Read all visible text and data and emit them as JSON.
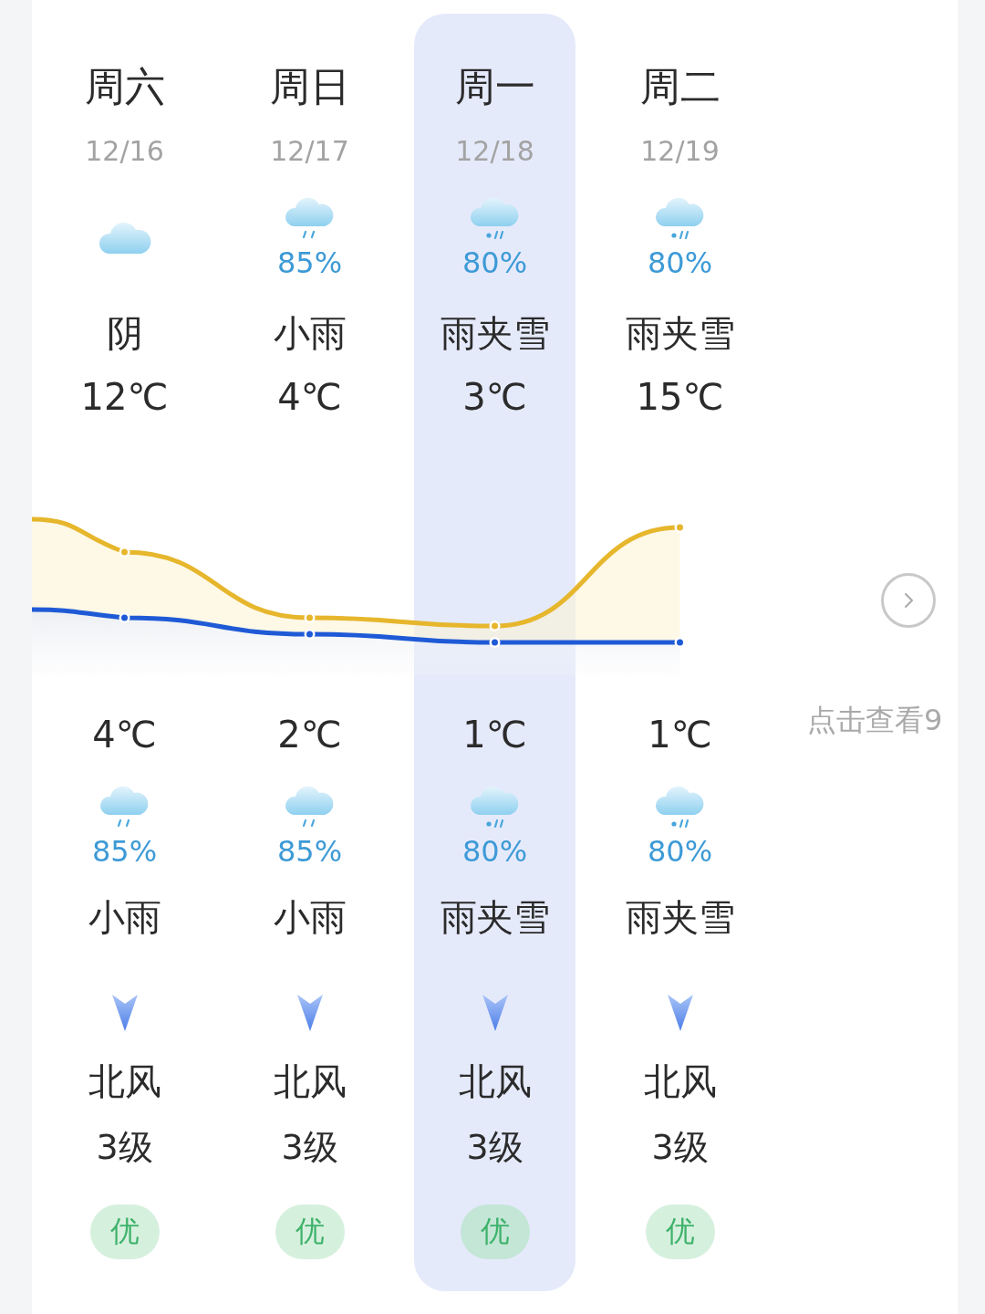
{
  "days": [
    {
      "weekday": "周六",
      "date": "12/16",
      "selected": false,
      "day": {
        "kind": "cloudy",
        "condition": "阴"
      },
      "high": "12℃",
      "low": "4℃",
      "night": {
        "kind": "rain",
        "precip": "85%",
        "condition": "小雨"
      },
      "wind_direction": "北风",
      "wind_level": "3级",
      "aqi": "优"
    },
    {
      "weekday": "周日",
      "date": "12/17",
      "selected": false,
      "day": {
        "kind": "rain",
        "precip": "85%",
        "condition": "小雨"
      },
      "high": "4℃",
      "low": "2℃",
      "night": {
        "kind": "rain",
        "precip": "85%",
        "condition": "小雨"
      },
      "wind_direction": "北风",
      "wind_level": "3级",
      "aqi": "优"
    },
    {
      "weekday": "周一",
      "date": "12/18",
      "selected": true,
      "day": {
        "kind": "sleet",
        "precip": "80%",
        "condition": "雨夹雪"
      },
      "high": "3℃",
      "low": "1℃",
      "night": {
        "kind": "sleet",
        "precip": "80%",
        "condition": "雨夹雪"
      },
      "wind_direction": "北风",
      "wind_level": "3级",
      "aqi": "优"
    },
    {
      "weekday": "周二",
      "date": "12/19",
      "selected": false,
      "day": {
        "kind": "sleet",
        "precip": "80%",
        "condition": "雨夹雪"
      },
      "high": "15℃",
      "low": "1℃",
      "night": {
        "kind": "sleet",
        "precip": "80%",
        "condition": "雨夹雪"
      },
      "wind_direction": "北风",
      "wind_level": "3级",
      "aqi": "优"
    }
  ],
  "more": {
    "label": "点击查看9"
  }
}
